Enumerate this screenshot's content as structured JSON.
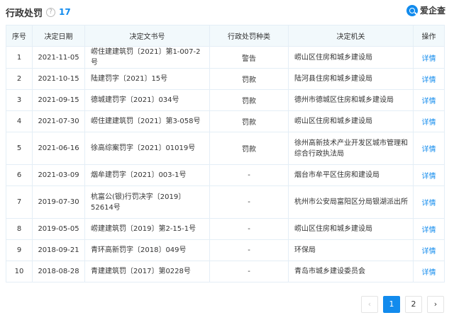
{
  "header": {
    "title": "行政处罚",
    "help_glyph": "?",
    "count": "17"
  },
  "brand": {
    "name": "爱企查",
    "icon": "search-logo-icon"
  },
  "table": {
    "columns": [
      "序号",
      "决定日期",
      "决定文书号",
      "行政处罚种类",
      "决定机关",
      "操作"
    ],
    "rows": [
      {
        "no": "1",
        "date": "2021-11-05",
        "doc": "崂住建建筑罚〔2021〕第1-007-2号",
        "type": "警告",
        "org": "崂山区住房和城乡建设局",
        "op": "详情"
      },
      {
        "no": "2",
        "date": "2021-10-15",
        "doc": "陆建罚字〔2021〕15号",
        "type": "罚款",
        "org": "陆河县住房和城乡建设局",
        "op": "详情"
      },
      {
        "no": "3",
        "date": "2021-09-15",
        "doc": "德城建罚字〔2021〕034号",
        "type": "罚款",
        "org": "德州市德城区住房和城乡建设局",
        "op": "详情"
      },
      {
        "no": "4",
        "date": "2021-07-30",
        "doc": "崂住建建筑罚〔2021〕第3-058号",
        "type": "罚款",
        "org": "崂山区住房和城乡建设局",
        "op": "详情"
      },
      {
        "no": "5",
        "date": "2021-06-16",
        "doc": "徐高综案罚字〔2021〕01019号",
        "type": "罚款",
        "org": "徐州高新技术产业开发区城市管理和综合行政执法局",
        "op": "详情"
      },
      {
        "no": "6",
        "date": "2021-03-09",
        "doc": "烟牟建罚字〔2021〕003-1号",
        "type": "-",
        "org": "烟台市牟平区住房和建设局",
        "op": "详情"
      },
      {
        "no": "7",
        "date": "2019-07-30",
        "doc": "杭富公(银)行罚决字〔2019〕52614号",
        "type": "-",
        "org": "杭州市公安局富阳区分局银湖派出所",
        "op": "详情"
      },
      {
        "no": "8",
        "date": "2019-05-05",
        "doc": "崂建建筑罚〔2019〕第2-15-1号",
        "type": "-",
        "org": "崂山区住房和城乡建设局",
        "op": "详情"
      },
      {
        "no": "9",
        "date": "2018-09-21",
        "doc": "青环高新罚字〔2018〕049号",
        "type": "-",
        "org": "环保局",
        "op": "详情"
      },
      {
        "no": "10",
        "date": "2018-08-28",
        "doc": "青建建筑罚〔2017〕第0228号",
        "type": "-",
        "org": "青岛市城乡建设委员会",
        "op": "详情"
      }
    ]
  },
  "pagination": {
    "prev": "‹",
    "pages": [
      "1",
      "2"
    ],
    "current": "1",
    "next": "›"
  }
}
